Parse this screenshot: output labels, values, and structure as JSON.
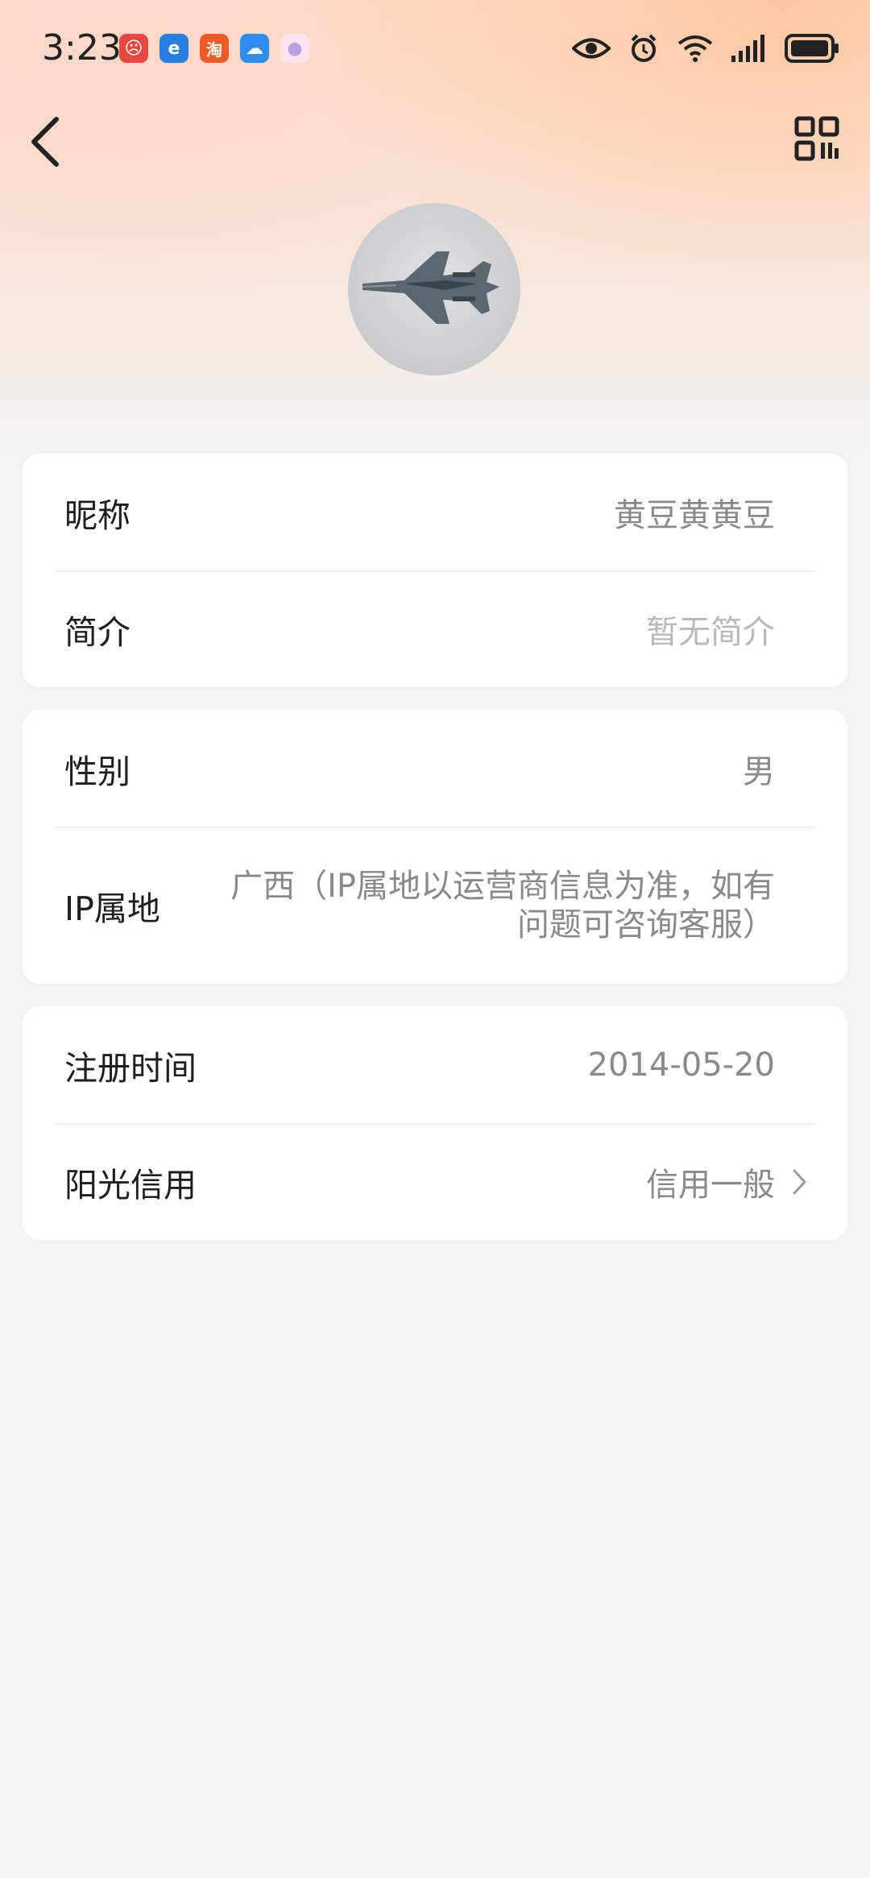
{
  "status_bar": {
    "time": "3:23",
    "apps": [
      {
        "name": "red-app-icon",
        "color": "#e8483f",
        "glyph": "☹"
      },
      {
        "name": "browser-app-icon",
        "color": "#2a7de1",
        "glyph": "e"
      },
      {
        "name": "taobao-app-icon",
        "color": "#f05a24",
        "glyph": "淘"
      },
      {
        "name": "weather-app-icon",
        "color": "#2f8cf0",
        "glyph": "☁"
      },
      {
        "name": "gallery-app-icon",
        "color": "#f2c9d8",
        "glyph": "●"
      }
    ],
    "right_icons": [
      "eye-icon",
      "alarm-icon",
      "wifi-icon",
      "signal-icon",
      "battery-icon"
    ]
  },
  "header": {
    "back_icon": "chevron-left-icon",
    "qr_icon": "qr-code-icon"
  },
  "profile": {
    "avatar_alt": "fighter-jet-avatar"
  },
  "cards": [
    {
      "rows": [
        {
          "label": "昵称",
          "value": "黄豆黄黄豆"
        },
        {
          "label": "简介",
          "value": "暂无简介"
        }
      ]
    },
    {
      "rows": [
        {
          "label": "性别",
          "value": "男"
        },
        {
          "label": "IP属地",
          "value_line1": "广西（IP属地以运营商信息为准，如有",
          "value_line2": "问题可咨询客服）"
        }
      ]
    },
    {
      "rows": [
        {
          "label": "注册时间",
          "value": "2014-05-20"
        },
        {
          "label": "阳光信用",
          "value": "信用一般"
        }
      ]
    }
  ],
  "colors": {
    "background": "#f3f3f3",
    "card": "#ffffff",
    "label": "#1f1f1f",
    "value": "#8a8a8a",
    "placeholder": "#b9b9b9",
    "header_gradient_start": "#ffc8a3"
  }
}
